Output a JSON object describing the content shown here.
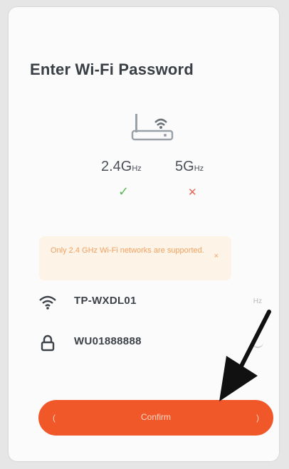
{
  "page": {
    "title": "Enter Wi-Fi Password"
  },
  "bands": {
    "band_24": {
      "main": "2.4G",
      "unit": "Hz",
      "status": "✓"
    },
    "band_5": {
      "main": "5G",
      "unit": "Hz",
      "status": "✕"
    }
  },
  "notice": {
    "text": "Only 2.4 GHz Wi-Fi networks are supported.",
    "close": "×"
  },
  "wifi": {
    "ssid": "TP-WXDL01",
    "ssid_aux": "Hz",
    "password": "WU01888888"
  },
  "actions": {
    "next_label": "Confirm",
    "decor_left": "(",
    "decor_right": ")"
  },
  "colors": {
    "accent": "#f0582a",
    "success": "#5cb85c",
    "error": "#e4685a",
    "notice_bg": "#fdf3e6",
    "notice_text": "#f2a160"
  },
  "icons": {
    "router": "router-icon",
    "wifi": "wifi-icon",
    "lock": "lock-icon",
    "eye": "eye-icon",
    "arrow": "pointer-arrow-icon"
  }
}
